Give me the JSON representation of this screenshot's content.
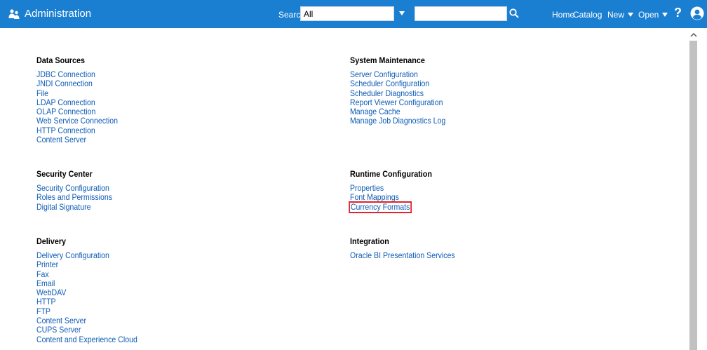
{
  "header": {
    "title": "Administration",
    "search_label": "Search",
    "search_scope": "All",
    "search_placeholder": "",
    "nav": {
      "home": "Home",
      "catalog": "Catalog",
      "new": "New",
      "open": "Open",
      "help": "?"
    },
    "icons": {
      "app": "admin-users-icon",
      "scope_dropdown": "caret-down-icon",
      "search": "search-icon",
      "user": "user-avatar-icon"
    }
  },
  "colors": {
    "header_bg": "#1b7fd1",
    "link": "#0d5bb5",
    "highlight": "#e0232c"
  },
  "sections": {
    "data_sources": {
      "title": "Data Sources",
      "links": [
        "JDBC Connection",
        "JNDI Connection",
        "File",
        "LDAP Connection",
        "OLAP Connection",
        "Web Service Connection",
        "HTTP Connection",
        "Content Server"
      ]
    },
    "security_center": {
      "title": "Security Center",
      "links": [
        "Security Configuration",
        "Roles and Permissions",
        "Digital Signature"
      ]
    },
    "delivery": {
      "title": "Delivery",
      "links": [
        "Delivery Configuration",
        "Printer",
        "Fax",
        "Email",
        "WebDAV",
        "HTTP",
        "FTP",
        "Content Server",
        "CUPS Server",
        "Content and Experience Cloud"
      ]
    },
    "system_maintenance": {
      "title": "System Maintenance",
      "links": [
        "Server Configuration",
        "Scheduler Configuration",
        "Scheduler Diagnostics",
        "Report Viewer Configuration",
        "Manage Cache",
        "Manage Job Diagnostics Log"
      ]
    },
    "runtime_configuration": {
      "title": "Runtime Configuration",
      "links": [
        "Properties",
        "Font Mappings",
        "Currency Formats"
      ],
      "highlighted_link": "Currency Formats"
    },
    "integration": {
      "title": "Integration",
      "links": [
        "Oracle BI Presentation Services"
      ]
    }
  }
}
